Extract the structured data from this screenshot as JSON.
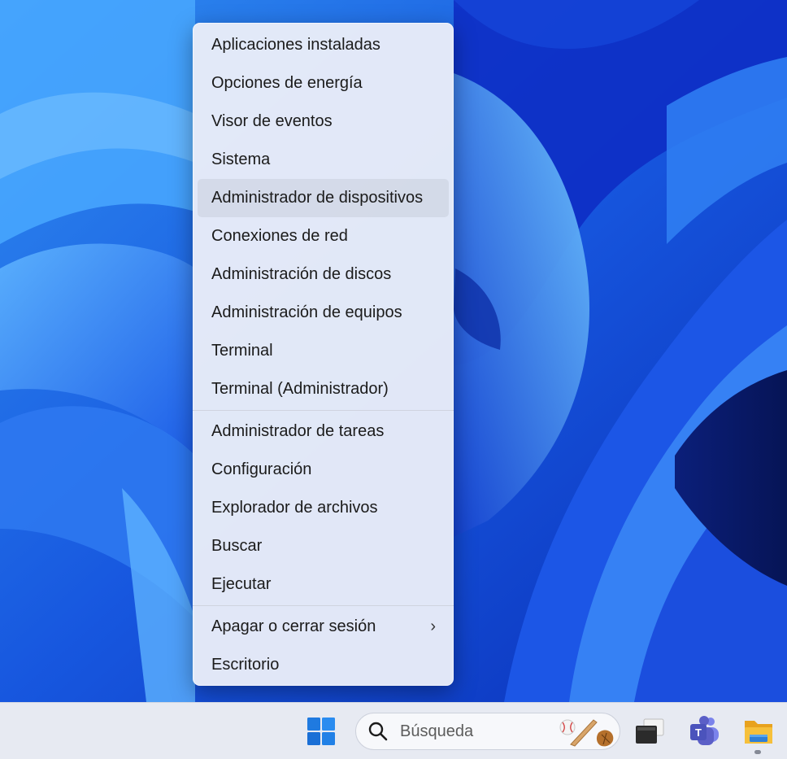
{
  "context_menu": {
    "groups": [
      [
        {
          "label": "Aplicaciones instaladas"
        },
        {
          "label": "Opciones de energía"
        },
        {
          "label": "Visor de eventos"
        },
        {
          "label": "Sistema"
        },
        {
          "label": "Administrador de dispositivos",
          "highlighted": true
        },
        {
          "label": "Conexiones de red"
        },
        {
          "label": "Administración de discos"
        },
        {
          "label": "Administración de equipos"
        },
        {
          "label": "Terminal"
        },
        {
          "label": "Terminal (Administrador)"
        }
      ],
      [
        {
          "label": "Administrador de tareas"
        },
        {
          "label": "Configuración"
        },
        {
          "label": "Explorador de archivos"
        },
        {
          "label": "Buscar"
        },
        {
          "label": "Ejecutar"
        }
      ],
      [
        {
          "label": "Apagar o cerrar sesión",
          "submenu": true,
          "chevron": "›"
        },
        {
          "label": "Escritorio"
        }
      ]
    ]
  },
  "taskbar": {
    "search_placeholder": "Búsqueda",
    "icons": [
      "windows-start-icon",
      "search-icon",
      "baseball-highlight-icon",
      "task-view-icon",
      "teams-icon",
      "file-explorer-icon"
    ]
  },
  "colors": {
    "wallpaper_blue": "#1a5fe0",
    "menu_background": "#e8ecf8",
    "taskbar_background": "#e7eaf2",
    "start_blue": "#1f7ae0",
    "folder_yellow": "#f6c03b"
  }
}
